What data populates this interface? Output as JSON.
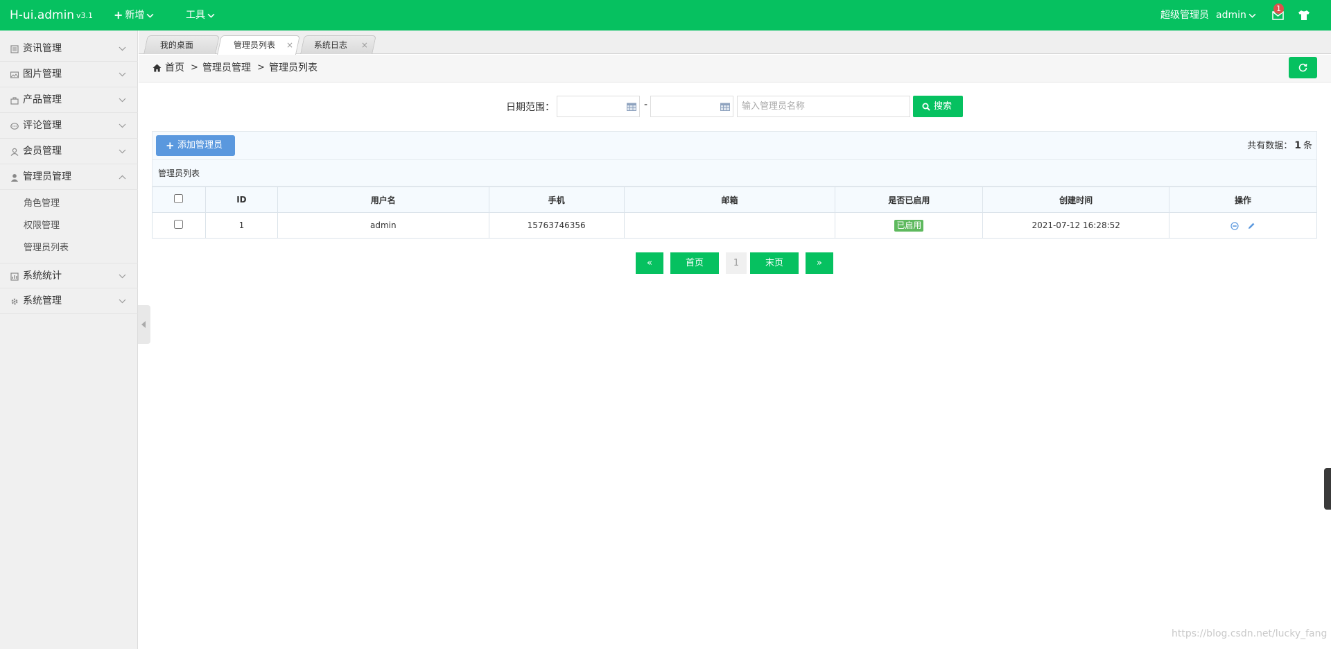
{
  "header": {
    "brand": "H-ui.admin",
    "version": "v3.1",
    "menu_new": "新增",
    "menu_tools": "工具",
    "user_role": "超级管理员",
    "user_name": "admin",
    "msg_count": "1",
    "accent": "#06c160"
  },
  "sidebar": {
    "items": [
      {
        "label": "资讯管理",
        "icon": "news-icon"
      },
      {
        "label": "图片管理",
        "icon": "picture-icon"
      },
      {
        "label": "产品管理",
        "icon": "product-icon"
      },
      {
        "label": "评论管理",
        "icon": "comment-icon"
      },
      {
        "label": "会员管理",
        "icon": "member-icon"
      },
      {
        "label": "管理员管理",
        "icon": "admin-user-icon"
      },
      {
        "label": "系统统计",
        "icon": "stats-icon"
      },
      {
        "label": "系统管理",
        "icon": "gear-icon"
      }
    ],
    "sub_items": [
      "角色管理",
      "权限管理",
      "管理员列表"
    ]
  },
  "tabs": [
    {
      "label": "我的桌面"
    },
    {
      "label": "管理员列表",
      "close": "×"
    },
    {
      "label": "系统日志",
      "close": "×"
    }
  ],
  "breadcrumb": {
    "home": "首页",
    "level1": "管理员管理",
    "level2": "管理员列表",
    "sep": ">"
  },
  "search": {
    "date_label": "日期范围：",
    "dash": "-",
    "name_placeholder": "输入管理员名称",
    "button": "搜索"
  },
  "toolbar": {
    "add_button": "添加管理员",
    "total_prefix": "共有数据：",
    "total_count": "1",
    "total_suffix": "条"
  },
  "table": {
    "caption": "管理员列表",
    "columns": [
      "ID",
      "用户名",
      "手机",
      "邮箱",
      "是否已启用",
      "创建时间",
      "操作"
    ],
    "rows": [
      {
        "id": "1",
        "username": "admin",
        "phone": "15763746356",
        "email": "",
        "status": "已启用",
        "created": "2021-07-12 16:28:52"
      }
    ]
  },
  "pagination": {
    "prev": "«",
    "first": "首页",
    "current": "1",
    "last": "末页",
    "next": "»"
  },
  "watermark": "https://blog.csdn.net/lucky_fang"
}
